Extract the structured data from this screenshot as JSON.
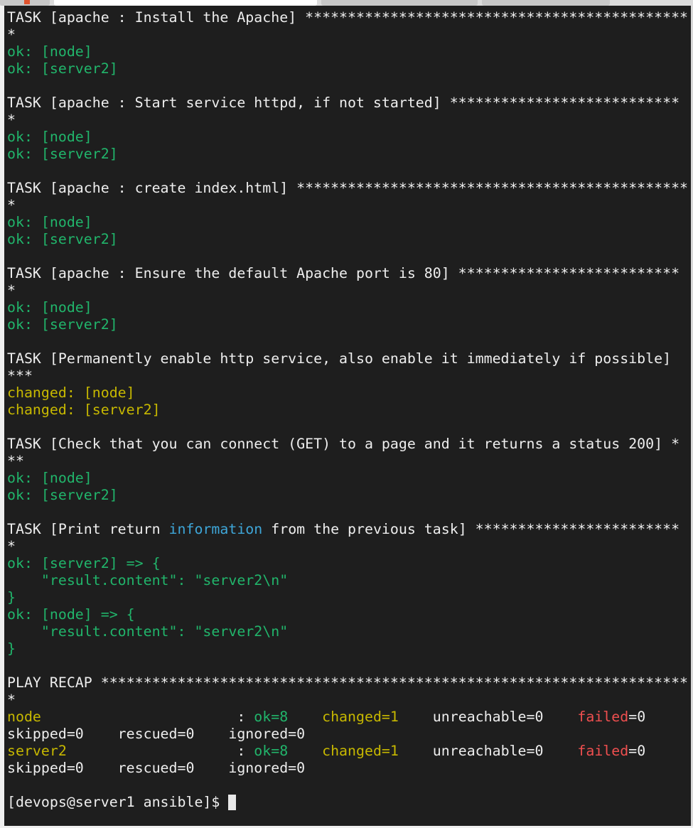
{
  "colors": {
    "default": "#eeeeee",
    "ok": "#21b56b",
    "changed": "#c7b800",
    "failed": "#ef4f4f",
    "info": "#3ea6d8",
    "background": "#1e1e1e"
  },
  "terminal": {
    "lines": [
      [
        {
          "t": "TASK [apache : Install the Apache] *********************************************",
          "c": "default"
        }
      ],
      [
        {
          "t": "*",
          "c": "default"
        }
      ],
      [
        {
          "t": "ok: [node]",
          "c": "ok"
        }
      ],
      [
        {
          "t": "ok: [server2]",
          "c": "ok"
        }
      ],
      [],
      [
        {
          "t": "TASK [apache : Start service httpd, if not started] ***************************",
          "c": "default"
        }
      ],
      [
        {
          "t": "*",
          "c": "default"
        }
      ],
      [
        {
          "t": "ok: [node]",
          "c": "ok"
        }
      ],
      [
        {
          "t": "ok: [server2]",
          "c": "ok"
        }
      ],
      [],
      [
        {
          "t": "TASK [apache : create index.html] **********************************************",
          "c": "default"
        }
      ],
      [
        {
          "t": "*",
          "c": "default"
        }
      ],
      [
        {
          "t": "ok: [node]",
          "c": "ok"
        }
      ],
      [
        {
          "t": "ok: [server2]",
          "c": "ok"
        }
      ],
      [],
      [
        {
          "t": "TASK [apache : Ensure the default Apache port is 80] **************************",
          "c": "default"
        }
      ],
      [
        {
          "t": "*",
          "c": "default"
        }
      ],
      [
        {
          "t": "ok: [node]",
          "c": "ok"
        }
      ],
      [
        {
          "t": "ok: [server2]",
          "c": "ok"
        }
      ],
      [],
      [
        {
          "t": "TASK [Permanently enable http service, also enable it immediately if possible]",
          "c": "default"
        }
      ],
      [
        {
          "t": "***",
          "c": "default"
        }
      ],
      [
        {
          "t": "changed: [node]",
          "c": "changed"
        }
      ],
      [
        {
          "t": "changed: [server2]",
          "c": "changed"
        }
      ],
      [],
      [
        {
          "t": "TASK [Check that you can connect (GET) to a page and it returns a status 200] *",
          "c": "default"
        }
      ],
      [
        {
          "t": "**",
          "c": "default"
        }
      ],
      [
        {
          "t": "ok: [node]",
          "c": "ok"
        }
      ],
      [
        {
          "t": "ok: [server2]",
          "c": "ok"
        }
      ],
      [],
      [
        {
          "t": "TASK [Print return ",
          "c": "default"
        },
        {
          "t": "information",
          "c": "info"
        },
        {
          "t": " from the previous task] ************************",
          "c": "default"
        }
      ],
      [
        {
          "t": "*",
          "c": "default"
        }
      ],
      [
        {
          "t": "ok: [server2] => {",
          "c": "ok"
        }
      ],
      [
        {
          "t": "    \"result.content\": \"server2\\n\"",
          "c": "ok"
        }
      ],
      [
        {
          "t": "}",
          "c": "ok"
        }
      ],
      [
        {
          "t": "ok: [node] => {",
          "c": "ok"
        }
      ],
      [
        {
          "t": "    \"result.content\": \"server2\\n\"",
          "c": "ok"
        }
      ],
      [
        {
          "t": "}",
          "c": "ok"
        }
      ],
      [],
      [
        {
          "t": "PLAY RECAP *********************************************************************",
          "c": "default"
        }
      ],
      [
        {
          "t": "*",
          "c": "default"
        }
      ],
      [
        {
          "t": "node",
          "c": "changed"
        },
        {
          "t": "                       : ",
          "c": "default"
        },
        {
          "t": "ok=8",
          "c": "ok"
        },
        {
          "t": "    ",
          "c": "default"
        },
        {
          "t": "changed=1",
          "c": "changed"
        },
        {
          "t": "    unreachable=0    ",
          "c": "default"
        },
        {
          "t": "failed",
          "c": "failed"
        },
        {
          "t": "=0",
          "c": "default"
        }
      ],
      [
        {
          "t": "skipped=0    rescued=0    ignored=0",
          "c": "default"
        }
      ],
      [
        {
          "t": "server2",
          "c": "changed"
        },
        {
          "t": "                    : ",
          "c": "default"
        },
        {
          "t": "ok=8",
          "c": "ok"
        },
        {
          "t": "    ",
          "c": "default"
        },
        {
          "t": "changed=1",
          "c": "changed"
        },
        {
          "t": "    unreachable=0    ",
          "c": "default"
        },
        {
          "t": "failed",
          "c": "failed"
        },
        {
          "t": "=0",
          "c": "default"
        }
      ],
      [
        {
          "t": "skipped=0    rescued=0    ignored=0",
          "c": "default"
        }
      ],
      [],
      [
        {
          "t": "[devops@server1 ansible]$ ",
          "c": "default"
        }
      ]
    ]
  }
}
